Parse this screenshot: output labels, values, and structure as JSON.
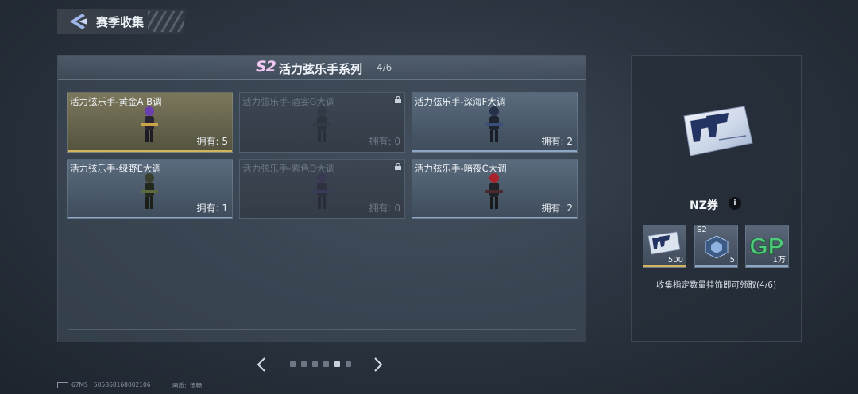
{
  "header": {
    "title": "赛季收集"
  },
  "series": {
    "season_badge": "S2",
    "title": "活力弦乐手系列",
    "progress": "4/6",
    "owned_prefix": "拥有:"
  },
  "cards": [
    {
      "name": "活力弦乐手-黄金A B调",
      "count": "拥有: 5",
      "state": "gold"
    },
    {
      "name": "活力弦乐手-酒宴G大调",
      "count": "拥有: 0",
      "state": "locked"
    },
    {
      "name": "活力弦乐手-深海F大调",
      "count": "拥有: 2",
      "state": "owned"
    },
    {
      "name": "活力弦乐手-绿野E大调",
      "count": "拥有: 1",
      "state": "owned"
    },
    {
      "name": "活力弦乐手-紫色D大调",
      "count": "拥有: 0",
      "state": "locked"
    },
    {
      "name": "活力弦乐手-暗夜C大调",
      "count": "拥有: 2",
      "state": "owned"
    }
  ],
  "pager": {
    "total_pages": 6,
    "current_page": 5
  },
  "reward": {
    "name": "NZ券",
    "items": [
      {
        "qty": "500",
        "icon": "nz-ticket-icon",
        "accent": "#d2b45c"
      },
      {
        "label": "S2",
        "qty": "5",
        "icon": "s2-crate-icon",
        "accent": "#8ea7c4"
      },
      {
        "qty": "1万",
        "icon": "gp-icon",
        "accent": "#8ea7c4"
      }
    ],
    "claim_text": "收集指定数量挂饰即可领取(4/6)"
  },
  "footer": {
    "ping": "67MS",
    "uid": "505868168002106",
    "quality_label": "画质:",
    "quality_value": "流畅"
  }
}
